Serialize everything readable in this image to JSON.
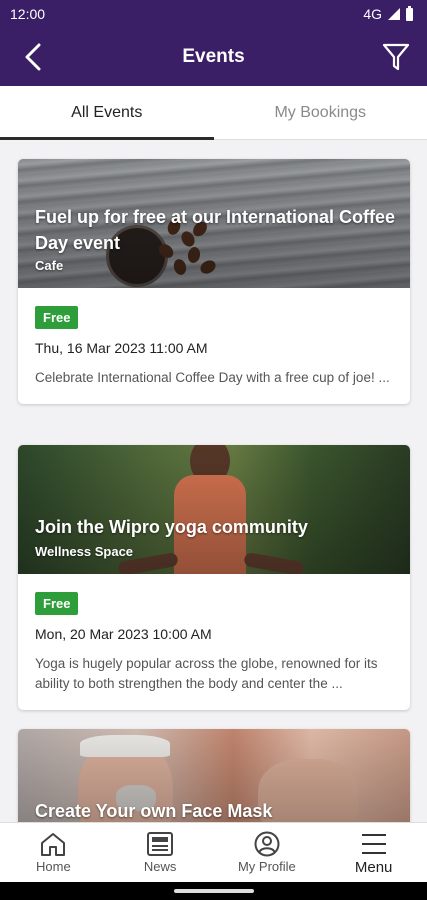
{
  "status_bar": {
    "time": "12:00",
    "network": "4G"
  },
  "app_bar": {
    "title": "Events",
    "back_icon": "back-arrow-icon",
    "filter_icon": "filter-icon"
  },
  "tabs": [
    {
      "label": "All Events",
      "active": true
    },
    {
      "label": "My Bookings",
      "active": false
    }
  ],
  "events": [
    {
      "title": "Fuel up for free at our International Coffee Day event",
      "location": "Cafe",
      "badge": "Free",
      "date": "Thu, 16 Mar 2023 11:00 AM",
      "description": "Celebrate International Coffee Day with a free cup of joe! ..."
    },
    {
      "title": "Join the Wipro yoga community",
      "location": "Wellness Space",
      "badge": "Free",
      "date": "Mon, 20 Mar 2023 10:00 AM",
      "description": "Yoga is hugely popular across the globe, renowned for its ability to both strengthen the body and center the ..."
    },
    {
      "title": "Create Your own Face Mask"
    }
  ],
  "bottom_nav": [
    {
      "label": "Home",
      "icon": "home-icon"
    },
    {
      "label": "News",
      "icon": "news-icon"
    },
    {
      "label": "My Profile",
      "icon": "profile-icon"
    },
    {
      "label": "Menu",
      "icon": "menu-icon"
    }
  ],
  "colors": {
    "brand": "#3a1f66",
    "badge": "#2e9e3a"
  }
}
